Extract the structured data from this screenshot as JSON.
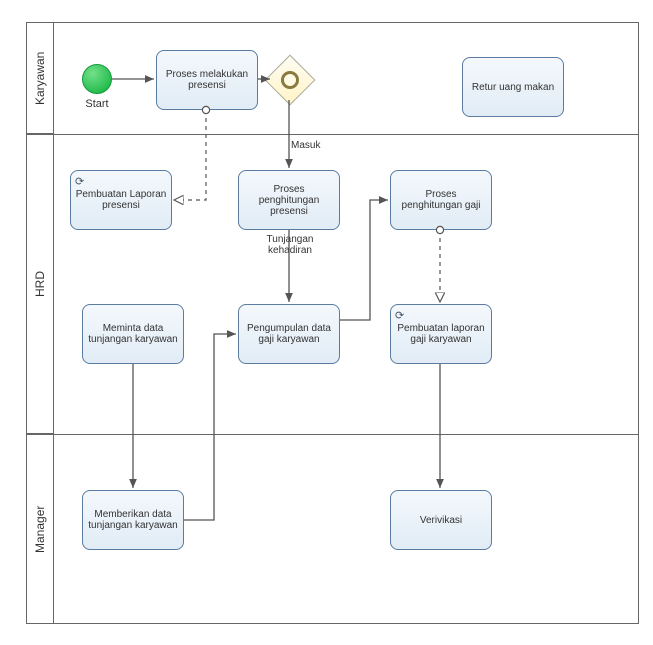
{
  "lanes": {
    "karyawan": "Karyawan",
    "hrd": "HRD",
    "manager": "Manager"
  },
  "events": {
    "start_label": "Start"
  },
  "tasks": {
    "proses_presensi": "Proses melakukan presensi",
    "retur_uang": "Retur uang makan",
    "pembuatan_laporan_presensi": "Pembuatan Laporan presensi",
    "proses_hitung_presensi": "Proses penghitungan presensi",
    "proses_hitung_gaji": "Proses penghitungan gaji",
    "meminta_data": "Meminta data tunjangan karyawan",
    "pengumpulan_data": "Pengumpulan data gaji karyawan",
    "pembuatan_laporan_gaji": "Pembuatan laporan gaji karyawan",
    "memberikan_data": "Memberikan data tunjangan karyawan",
    "verifikasi": "Verivikasi"
  },
  "edge_labels": {
    "masuk": "Masuk",
    "tunjangan": "Tunjangan kehadiran"
  }
}
